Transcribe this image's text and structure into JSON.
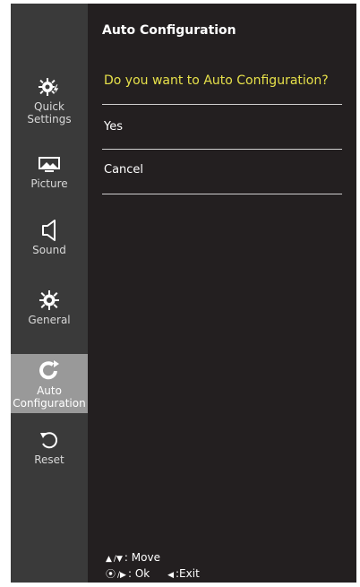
{
  "sidebar": {
    "items": [
      {
        "label_lines": [
          "Quick",
          "Settings"
        ],
        "icon": "quick-settings-icon"
      },
      {
        "label_lines": [
          "Picture"
        ],
        "icon": "picture-icon"
      },
      {
        "label_lines": [
          "Sound"
        ],
        "icon": "speaker-icon"
      },
      {
        "label_lines": [
          "General"
        ],
        "icon": "gear-icon"
      },
      {
        "label_lines": [
          "Auto",
          "Configuration"
        ],
        "icon": "auto-configuration-icon",
        "active": true
      },
      {
        "label_lines": [
          "Reset"
        ],
        "icon": "reset-icon"
      }
    ]
  },
  "main": {
    "title": "Auto Configuration",
    "question": "Do you want to Auto Configuration?",
    "options": [
      "Yes",
      "Cancel"
    ]
  },
  "hints": {
    "move_label": "Move",
    "ok_label": "Ok",
    "exit_label": "Exit",
    "move_sep": "/",
    "ok_sep": "/",
    "colon": ":"
  },
  "colors": {
    "panel_bg": "#231f20",
    "sidebar_bg": "#3a3a3a",
    "active_bg": "#999999",
    "question_color": "#e6e04a"
  }
}
